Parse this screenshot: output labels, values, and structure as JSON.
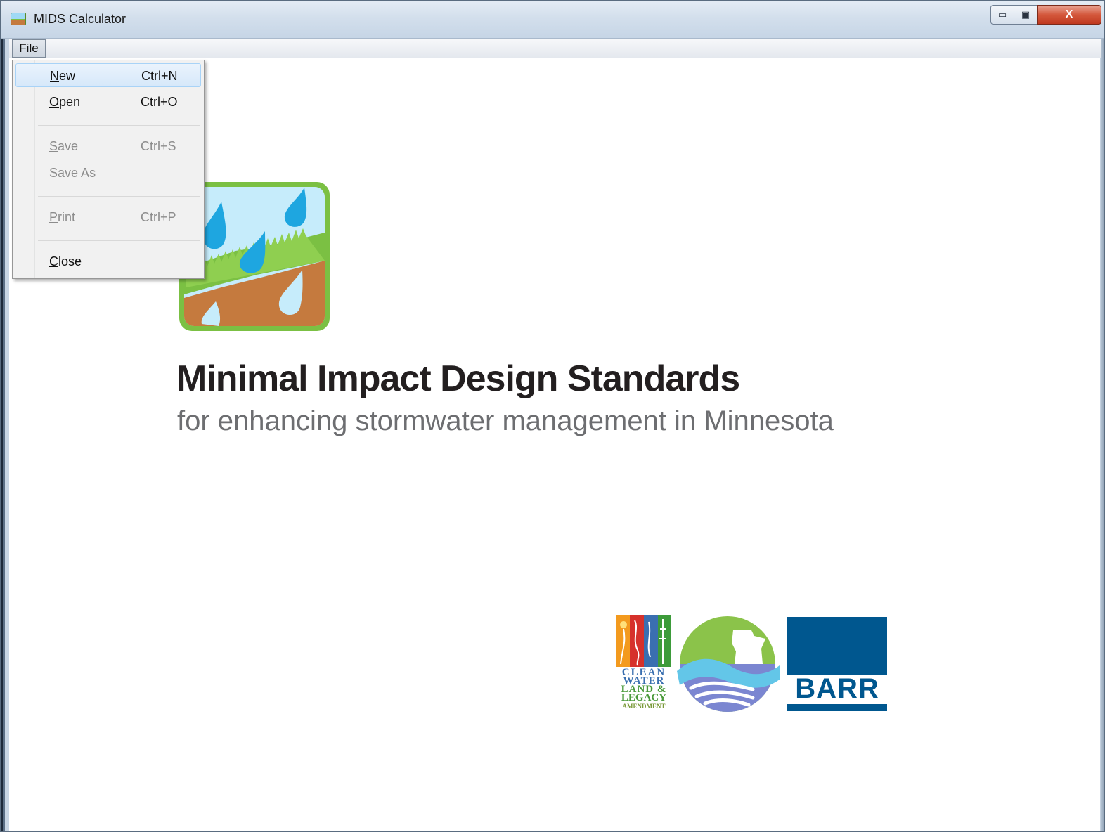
{
  "window": {
    "title": "MIDS Calculator",
    "minimize_glyph": "▭",
    "maximize_glyph": "▣",
    "close_glyph": "X"
  },
  "menubar": {
    "file_label": "File"
  },
  "file_menu": {
    "items": [
      {
        "label": "New",
        "mnemonic": "N",
        "rest": "ew",
        "shortcut": "Ctrl+N",
        "enabled": true,
        "highlighted": true
      },
      {
        "label": "Open",
        "mnemonic": "O",
        "rest": "pen",
        "shortcut": "Ctrl+O",
        "enabled": true
      },
      {
        "label": "Save",
        "mnemonic": "S",
        "rest": "ave",
        "shortcut": "Ctrl+S",
        "enabled": false
      },
      {
        "label": "Save As",
        "pre": "Save ",
        "mnemonic": "A",
        "rest": "s",
        "shortcut": "",
        "enabled": false
      },
      {
        "label": "Print",
        "mnemonic": "P",
        "rest": "rint",
        "shortcut": "Ctrl+P",
        "enabled": false
      },
      {
        "label": "Close",
        "mnemonic": "C",
        "rest": "lose",
        "shortcut": "",
        "enabled": true
      }
    ]
  },
  "hero": {
    "title": "Minimal Impact Design Standards",
    "subtitle": "for enhancing stormwater management in Minnesota"
  },
  "logos": {
    "clean_water": {
      "line1": "CLEAN",
      "line2": "WATER",
      "line3": "LAND &",
      "line4": "LEGACY",
      "line5": "AMENDMENT"
    },
    "barr": "BARR"
  },
  "colors": {
    "barr_blue": "#00578f",
    "icon_green": "#7bc043",
    "icon_soil": "#c57a3e",
    "icon_sky": "#c6ecfb",
    "icon_drop": "#1ea6e0"
  }
}
